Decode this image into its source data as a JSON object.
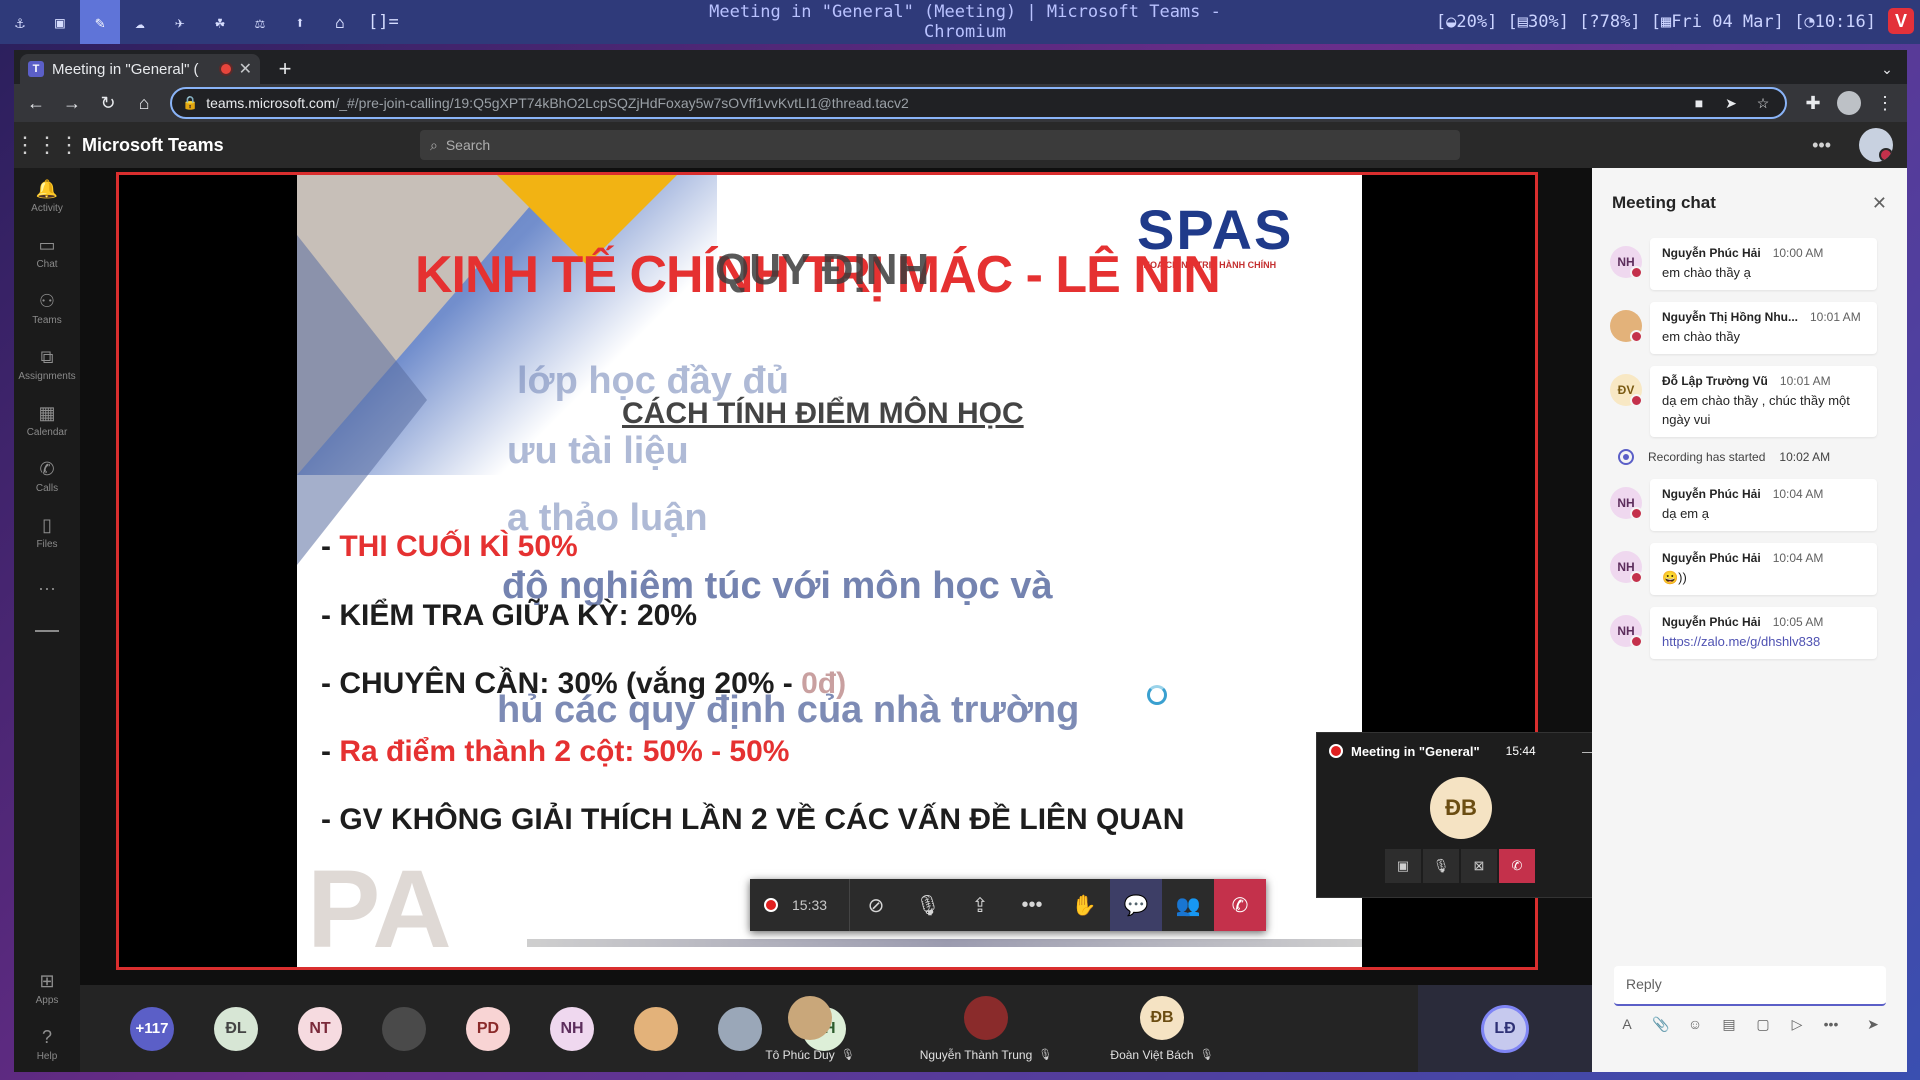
{
  "wm": {
    "workspaces": [
      "⚓",
      "▣",
      "✎",
      "☁",
      "✈",
      "☘",
      "⚖",
      "⬆",
      "⌂"
    ],
    "layout": "[]=",
    "window_title": "Meeting in \"General\" (Meeting) | Microsoft Teams - Chromium",
    "status": "[◒20%] [▤30%] [?78%] [▦Fri 04 Mar] [◔10:16]",
    "browser_badge": "V"
  },
  "browser": {
    "tab_title": "Meeting in \"General\" (",
    "url_host": "teams.microsoft.com",
    "url_path": "/_#/pre-join-calling/19:Q5gXPT74kBhO2LcpSQZjHdFoxay5w7sOVff1vvKvtLI1@thread.tacv2"
  },
  "teams": {
    "app_name": "Microsoft Teams",
    "search_placeholder": "Search",
    "rail": [
      {
        "label": "Activity",
        "icon": "bell-icon"
      },
      {
        "label": "Chat",
        "icon": "chat-icon"
      },
      {
        "label": "Teams",
        "icon": "teams-icon"
      },
      {
        "label": "Assignments",
        "icon": "assignments-icon"
      },
      {
        "label": "Calendar",
        "icon": "calendar-icon"
      },
      {
        "label": "Calls",
        "icon": "phone-icon"
      },
      {
        "label": "Files",
        "icon": "file-icon"
      }
    ],
    "rail_bottom": [
      {
        "label": "Apps",
        "icon": "apps-icon"
      },
      {
        "label": "Help",
        "icon": "help-icon"
      }
    ]
  },
  "slide": {
    "heading": "KINH TẾ CHÍNH TRỊ MÁC - LÊ NIN",
    "heading_overlay": "QUY ĐỊNH",
    "logo_text": "SPAS",
    "logo_sub": "KHOA CHÍNH TRỊ - HÀNH CHÍNH",
    "ghost_lines": [
      "lớp học đầy đủ",
      "ưu tài liệu",
      "a thảo luận",
      "độ nghiêm túc với môn học và",
      "hủ các quy định của nhà trường"
    ],
    "subheading": "CÁCH TÍNH ĐIỂM MÔN HỌC",
    "line1_dash": "- ",
    "line1": "THI CUỐI KÌ 50%",
    "line2": "- KIỂM TRA GIỮA KỲ: 20%",
    "line3_main": "- CHUYÊN CẦN: 30% (vắng 20% - ",
    "line3_tail": "0đ)",
    "line4_dash": "- ",
    "line4": "Ra điểm thành 2 cột: 50% - 50%",
    "line5": "- GV KHÔNG GIẢI THÍCH LẦN 2 VỀ CÁC VẤN ĐỀ LIÊN QUAN"
  },
  "mini_window": {
    "title": "Meeting in \"General\"",
    "time": "15:44",
    "avatar": "ĐB"
  },
  "callbar": {
    "time": "15:33"
  },
  "roster": {
    "overflow": "+117",
    "avatars": [
      "ĐL",
      "NT",
      "",
      "PD",
      "NH",
      "",
      "",
      "NH"
    ],
    "tiles": [
      {
        "name": "Tô Phúc Duy"
      },
      {
        "name": "Nguyễn Thành Trung"
      },
      {
        "name": "Đoàn Việt Bách",
        "initials": "ĐB"
      }
    ],
    "self_initials": "LĐ"
  },
  "chat": {
    "title": "Meeting chat",
    "messages": [
      {
        "initials": "NH",
        "name": "Nguyễn Phúc Hải",
        "time": "10:00 AM",
        "text": "em chào thầy ạ"
      },
      {
        "initials": "",
        "name": "Nguyễn Thị Hồng Nhu...",
        "time": "10:01 AM",
        "text": "em chào thầy"
      },
      {
        "initials": "ĐV",
        "name": "Đỗ Lập Trường Vũ",
        "time": "10:01 AM",
        "text": "dạ em chào thầy , chúc thầy một ngày vui"
      },
      {
        "initials": "NH",
        "name": "Nguyễn Phúc Hải",
        "time": "10:04 AM",
        "text": "dạ em ạ"
      },
      {
        "initials": "NH",
        "name": "Nguyễn Phúc Hải",
        "time": "10:04 AM",
        "text": "😀))"
      },
      {
        "initials": "NH",
        "name": "Nguyễn Phúc Hải",
        "time": "10:05 AM",
        "text": "https://zalo.me/g/dhshlv838"
      }
    ],
    "system": {
      "text": "Recording has started",
      "time": "10:02 AM"
    },
    "reply_placeholder": "Reply"
  }
}
